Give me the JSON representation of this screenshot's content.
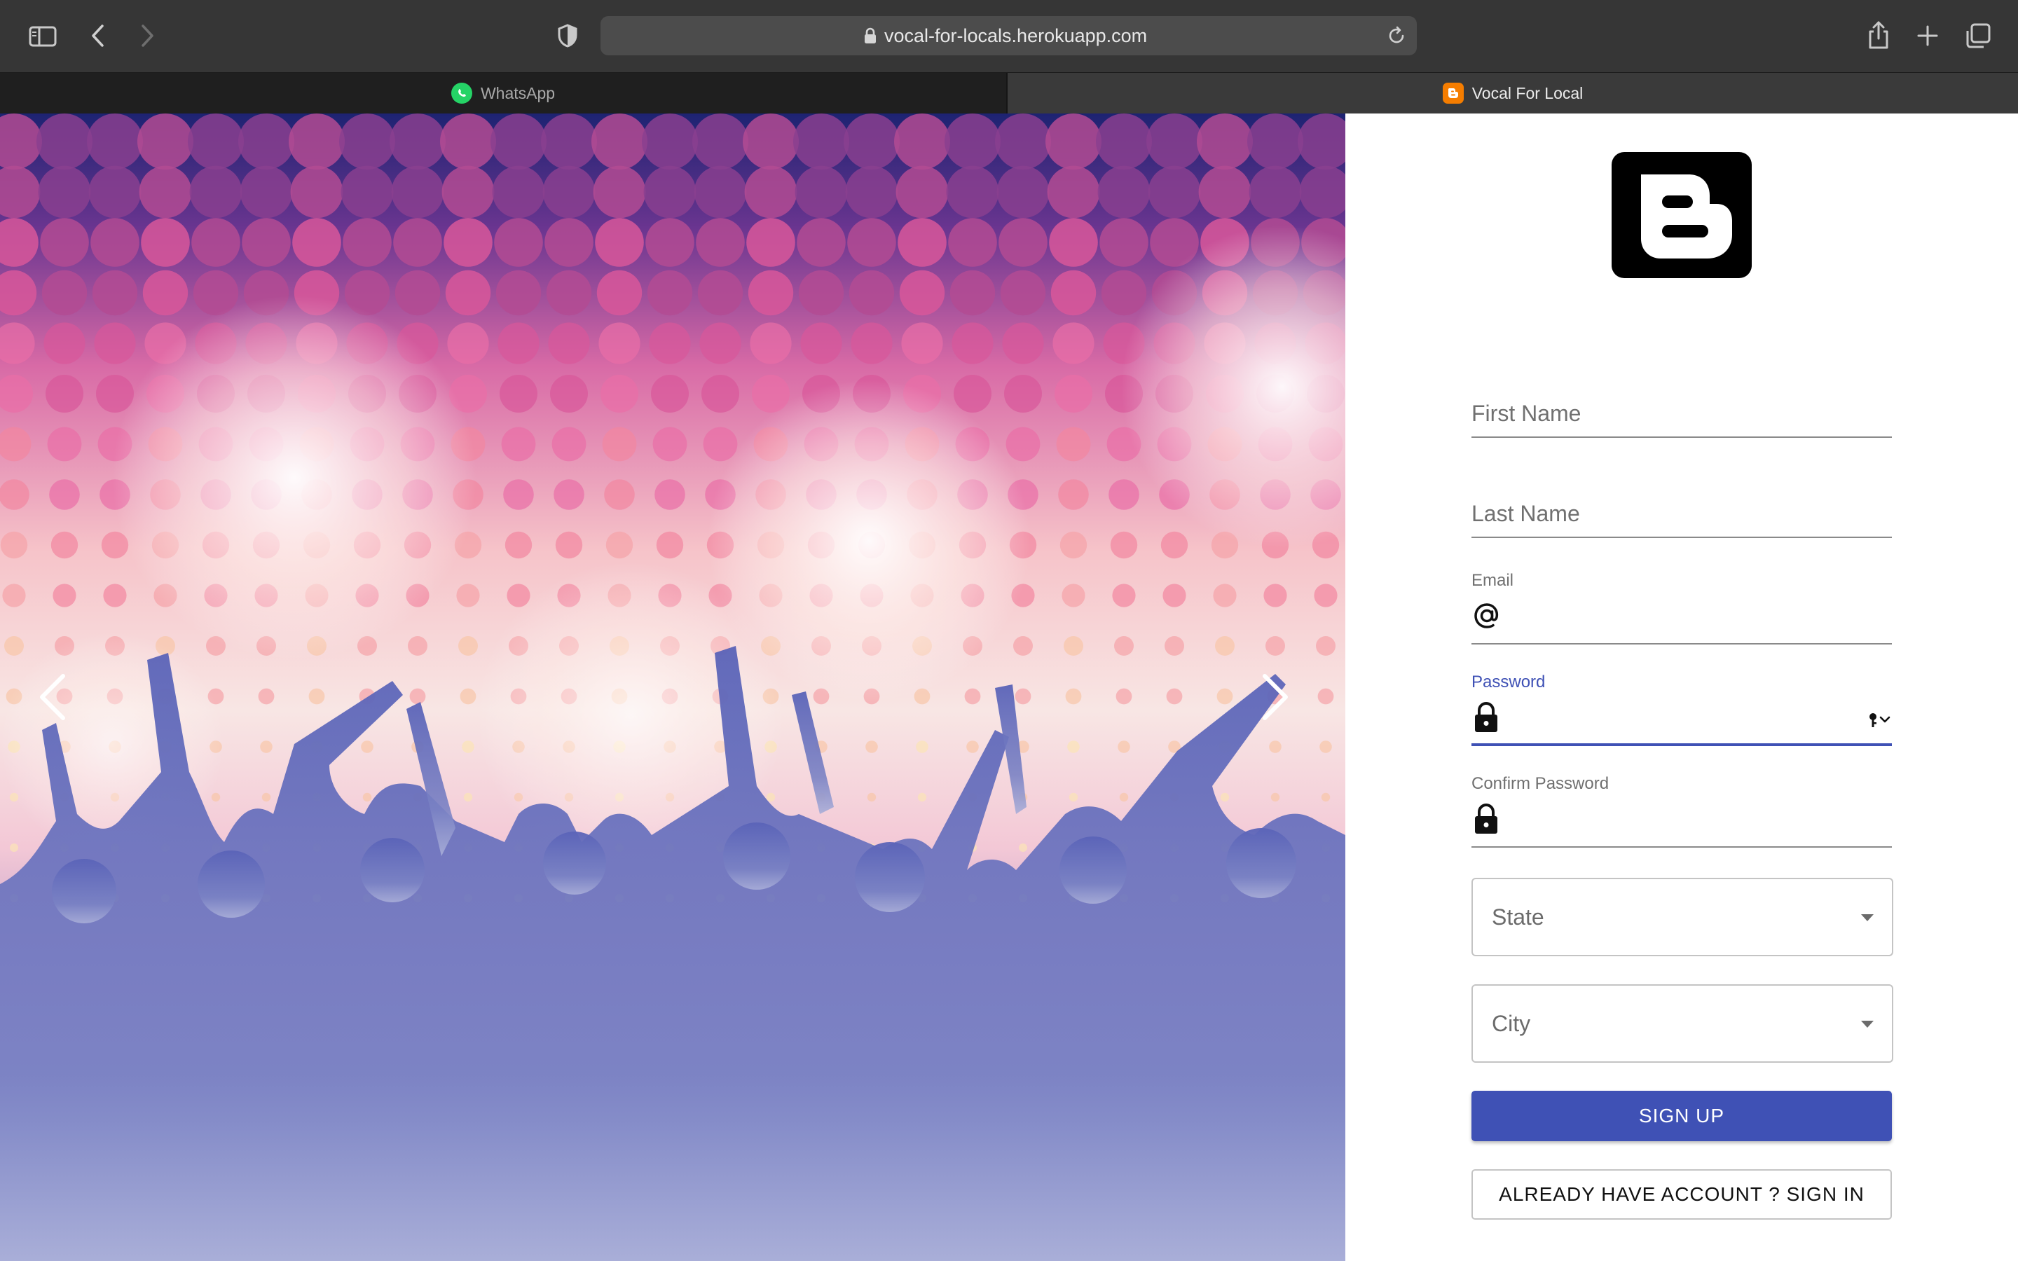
{
  "browser": {
    "url": "vocal-for-locals.herokuapp.com",
    "tabs": [
      {
        "label": "WhatsApp",
        "favicon": "whatsapp-icon",
        "active": false
      },
      {
        "label": "Vocal For Local",
        "favicon": "blogger-icon",
        "active": true
      }
    ],
    "icons": [
      "sidebar-icon",
      "back-icon",
      "forward-icon",
      "privacy-shield-icon",
      "lock-icon",
      "reload-icon",
      "share-icon",
      "new-tab-icon",
      "tab-overview-icon"
    ]
  },
  "hero": {
    "prev_icon": "chevron-left-icon",
    "next_icon": "chevron-right-icon"
  },
  "form": {
    "logo_icon": "blogger-icon",
    "first_name": {
      "placeholder": "First Name"
    },
    "last_name": {
      "placeholder": "Last Name"
    },
    "email": {
      "label": "Email",
      "icon": "at-icon",
      "value": ""
    },
    "password": {
      "label": "Password",
      "icon": "lock-icon",
      "value": "",
      "focused": true,
      "autofill_icon": "key-icon"
    },
    "confirm_password": {
      "label": "Confirm Password",
      "icon": "lock-icon",
      "value": ""
    },
    "state": {
      "label": "State"
    },
    "city": {
      "label": "City"
    },
    "signup_label": "SIGN UP",
    "signin_label": "ALREADY HAVE ACCOUNT ? SIGN IN"
  },
  "colors": {
    "primary": "#3f51b5",
    "focus_label": "#3f51b5",
    "whatsapp_green": "#25d366",
    "blogger_orange": "#f57d00"
  }
}
